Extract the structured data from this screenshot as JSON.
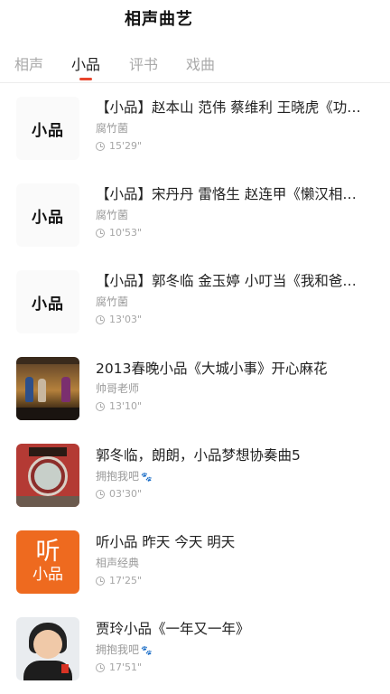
{
  "header": {
    "title": "相声曲艺"
  },
  "tabs": [
    {
      "label": "相声"
    },
    {
      "label": "小品"
    },
    {
      "label": "评书"
    },
    {
      "label": "戏曲"
    }
  ],
  "active_tab": "小品",
  "accent_color": "#e8452c",
  "items": [
    {
      "title": "【小品】赵本山 范伟 蔡维利 王晓虎《功夫》",
      "author": "腐竹菌",
      "duration": "15'29\"",
      "thumb_text": "小品",
      "thumb": "calligraphy"
    },
    {
      "title": "【小品】宋丹丹 雷恪生 赵连甲《懒汉相亲》",
      "author": "腐竹菌",
      "duration": "10'53\"",
      "thumb_text": "小品",
      "thumb": "calligraphy"
    },
    {
      "title": "【小品】郭冬临 金玉婷 小叮当《我和爸爸》",
      "author": "腐竹菌",
      "duration": "13'03\"",
      "thumb_text": "小品",
      "thumb": "calligraphy"
    },
    {
      "title": "2013春晚小品《大城小事》开心麻花",
      "author": "帅哥老师",
      "duration": "13'10\"",
      "thumb": "stage"
    },
    {
      "title": "郭冬临，朗朗，小品梦想协奏曲5",
      "author": "拥抱我吧",
      "duration": "03'30\"",
      "thumb": "moongate"
    },
    {
      "title": "听小品 昨天 今天 明天",
      "author": "相声经典",
      "duration": "17'25\"",
      "thumb": "tingxiaopin",
      "thumb_text_1": "听",
      "thumb_text_2": "小品"
    },
    {
      "title": "贾玲小品《一年又一年》",
      "author": "拥抱我吧",
      "duration": "17'51\"",
      "thumb": "portrait"
    }
  ]
}
